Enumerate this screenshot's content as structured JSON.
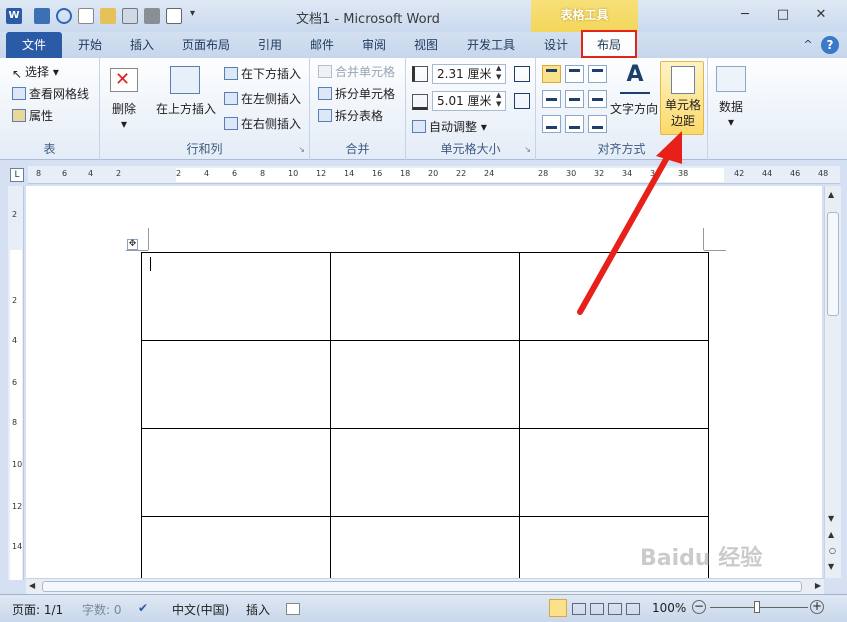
{
  "title_bar": {
    "window_title": "文档1 - Microsoft Word",
    "context_group": "表格工具",
    "buttons": {
      "minimize": "─",
      "maximize": "□",
      "close": "✕"
    }
  },
  "tabs": {
    "file": "文件",
    "items": [
      "开始",
      "插入",
      "页面布局",
      "引用",
      "邮件",
      "审阅",
      "视图",
      "开发工具",
      "设计",
      "布局"
    ],
    "help": "?"
  },
  "ribbon": {
    "group_table": {
      "select": "选择",
      "gridlines": "查看网格线",
      "properties": "属性",
      "label": "表"
    },
    "group_rows_cols": {
      "delete": "删除",
      "insert_above": "在上方插入",
      "insert_below": "在下方插入",
      "insert_left": "在左侧插入",
      "insert_right": "在右侧插入",
      "label": "行和列"
    },
    "group_merge": {
      "merge_cells": "合并单元格",
      "split_cells": "拆分单元格",
      "split_table": "拆分表格",
      "label": "合并"
    },
    "group_cell_size": {
      "height": "2.31 厘米",
      "width": "5.01 厘米",
      "autofit": "自动调整",
      "label": "单元格大小"
    },
    "group_alignment": {
      "text_direction": "文字方向",
      "cell_margins_line1": "单元格",
      "cell_margins_line2": "边距",
      "label": "对齐方式"
    },
    "group_data": {
      "data": "数据"
    }
  },
  "ruler": {
    "h_ticks": [
      "8",
      "6",
      "4",
      "2",
      "2",
      "4",
      "6",
      "8",
      "10",
      "12",
      "14",
      "16",
      "18",
      "20",
      "22",
      "24",
      "28",
      "30",
      "32",
      "34",
      "36",
      "38",
      "42",
      "44",
      "46",
      "48"
    ],
    "v_ticks": [
      "2",
      "2",
      "4",
      "6",
      "8",
      "10",
      "12",
      "14"
    ]
  },
  "status_bar": {
    "page": "页面: 1/1",
    "words": "字数: 0",
    "language": "中文(中国)",
    "insert_mode": "插入",
    "zoom": "100%"
  },
  "colors": {
    "file_tab": "#2a5ba6",
    "context_tab": "#f3d65a",
    "highlight_box": "#e2231a",
    "arrow": "#e8201a"
  },
  "watermark": "Baidu 经验"
}
